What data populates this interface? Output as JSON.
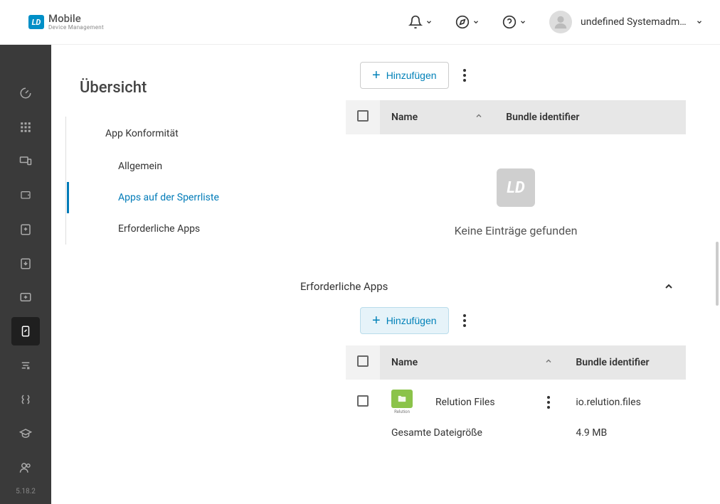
{
  "brand": {
    "logo_text": "LD",
    "title": "Mobile",
    "subtitle": "Device Management"
  },
  "header": {
    "username": "undefined Systemadmi..."
  },
  "rail": {
    "version": "5.18.2"
  },
  "sidebar": {
    "title": "Übersicht",
    "group_label": "App Konformität",
    "items": [
      {
        "label": "Allgemein"
      },
      {
        "label": "Apps auf der Sperrliste"
      },
      {
        "label": "Erforderliche Apps"
      }
    ]
  },
  "panels": {
    "blocked": {
      "add_label": "Hinzufügen",
      "cols": {
        "name": "Name",
        "bundle": "Bundle identifier"
      },
      "empty": "Keine Einträge gefunden",
      "empty_logo": "LD"
    },
    "required": {
      "title": "Erforderliche Apps",
      "add_label": "Hinzufügen",
      "cols": {
        "name": "Name",
        "bundle": "Bundle identifier"
      },
      "rows": [
        {
          "name": "Relution Files",
          "bundle": "io.relution.files",
          "icon_label": "Relution",
          "size_label": "Gesamte Dateigröße",
          "size_value": "4.9 MB"
        }
      ]
    }
  }
}
